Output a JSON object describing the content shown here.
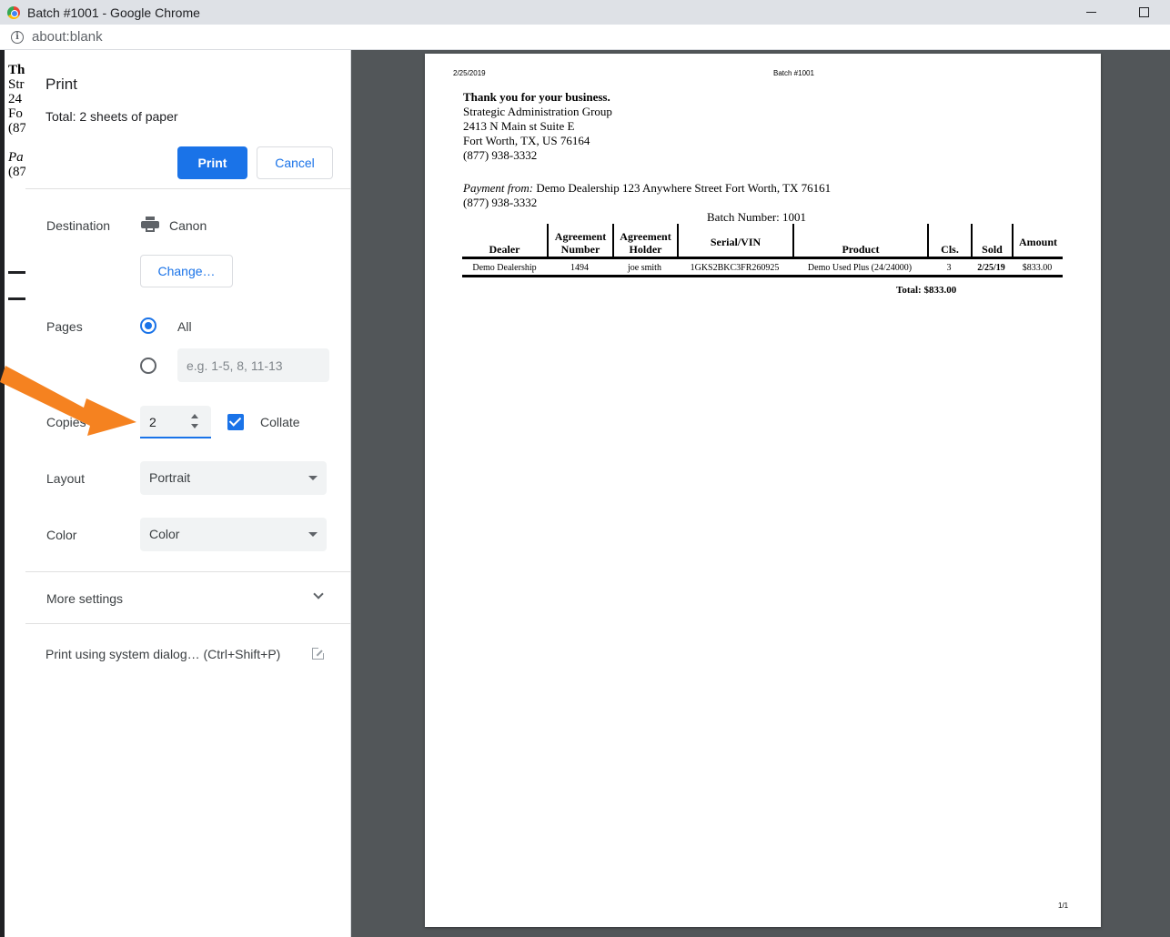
{
  "window": {
    "title": "Batch #1001 - Google Chrome",
    "url": "about:blank"
  },
  "background_page": {
    "lines": [
      "Th",
      "Str",
      "24",
      "Fo",
      "(87",
      "Pa",
      "(87"
    ]
  },
  "print_panel": {
    "title": "Print",
    "total": "Total: 2 sheets of paper",
    "print_label": "Print",
    "cancel_label": "Cancel",
    "destination_label": "Destination",
    "destination_value": "Canon",
    "change_label": "Change…",
    "pages_label": "Pages",
    "pages_all": "All",
    "pages_placeholder": "e.g. 1-5, 8, 11-13",
    "copies_label": "Copies",
    "copies_value": "2",
    "collate_label": "Collate",
    "layout_label": "Layout",
    "layout_value": "Portrait",
    "color_label": "Color",
    "color_value": "Color",
    "more_settings": "More settings",
    "system_dialog": "Print using system dialog… (Ctrl+Shift+P)"
  },
  "colors": {
    "accent": "#1a73e8",
    "arrow": "#f58220",
    "preview_bg": "#525659"
  },
  "preview": {
    "header_date": "2/25/2019",
    "header_batch": "Batch #1001",
    "thanks": "Thank you for your business.",
    "company": "Strategic Administration Group",
    "address1": "2413 N Main st Suite E",
    "address2": "Fort Worth, TX, US 76164",
    "phone": "(877) 938-3332",
    "payment_from_label": "Payment from:",
    "payment_from_value": " Demo Dealership 123 Anywhere Street Fort Worth,  TX 76161",
    "payment_phone": "(877) 938-3332",
    "batch_number": "Batch Number: 1001",
    "table": {
      "headers": [
        "Dealer",
        "Agreement Number",
        "Agreement Holder",
        "Serial/VIN",
        "Product",
        "Cls.",
        "Sold",
        "Amount"
      ],
      "rows": [
        [
          "Demo Dealership",
          "1494",
          "joe smith",
          "1GKS2BKC3FR260925",
          "Demo Used Plus  (24/24000)",
          "3",
          "2/25/19",
          "$833.00"
        ]
      ],
      "total": "Total:  $833.00"
    },
    "page_number": "1/1"
  }
}
